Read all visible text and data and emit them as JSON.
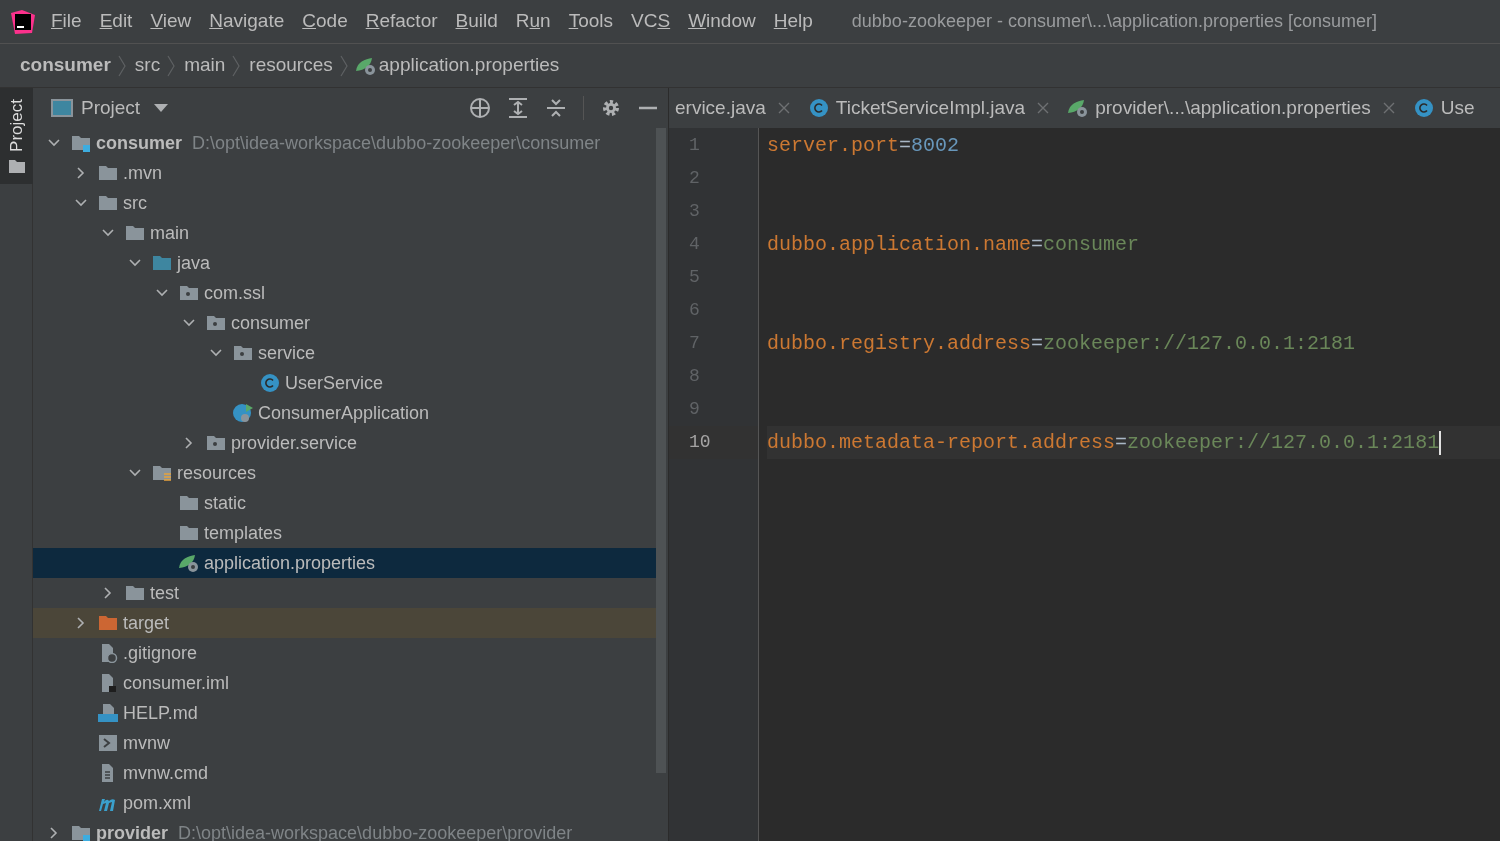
{
  "menu_bar": {
    "items": [
      {
        "mnemonic": "F",
        "after": "ile"
      },
      {
        "mnemonic": "E",
        "after": "dit"
      },
      {
        "mnemonic": "V",
        "after": "iew"
      },
      {
        "mnemonic": "N",
        "after": "avigate"
      },
      {
        "mnemonic": "C",
        "after": "ode"
      },
      {
        "mnemonic": "R",
        "after": "efactor"
      },
      {
        "mnemonic": "B",
        "after": "uild"
      },
      {
        "before": "R",
        "mnemonic": "u",
        "after": "n"
      },
      {
        "mnemonic": "T",
        "after": "ools"
      },
      {
        "before": "VC",
        "mnemonic": "S"
      },
      {
        "mnemonic": "W",
        "after": "indow"
      },
      {
        "mnemonic": "H",
        "after": "elp"
      }
    ],
    "title": "dubbo-zookeeper - consumer\\...\\application.properties [consumer]"
  },
  "breadcrumb": [
    {
      "label": "consumer",
      "kind": "module"
    },
    {
      "label": "src",
      "kind": "folder"
    },
    {
      "label": "main",
      "kind": "folder"
    },
    {
      "label": "resources",
      "kind": "folder"
    },
    {
      "label": "application.properties",
      "kind": "properties"
    }
  ],
  "side_stripe": {
    "tab": {
      "label": "Project",
      "selected": true
    }
  },
  "project_panel": {
    "title": "Project",
    "tree": [
      {
        "label": "consumer",
        "kind": "module",
        "path": "D:\\opt\\idea-workspace\\dubbo-zookeeper\\consumer",
        "expanded": true,
        "selected": false,
        "children": [
          {
            "label": ".mvn",
            "kind": "folder",
            "expanded": false,
            "selected": false
          },
          {
            "label": "src",
            "kind": "folder",
            "expanded": true,
            "selected": false,
            "children": [
              {
                "label": "main",
                "kind": "folder",
                "expanded": true,
                "selected": false,
                "children": [
                  {
                    "label": "java",
                    "kind": "source-folder",
                    "expanded": true,
                    "selected": false,
                    "children": [
                      {
                        "label": "com.ssl",
                        "kind": "package",
                        "expanded": true,
                        "selected": false,
                        "children": [
                          {
                            "label": "consumer",
                            "kind": "package",
                            "expanded": true,
                            "selected": false,
                            "children": [
                              {
                                "label": "service",
                                "kind": "package",
                                "expanded": true,
                                "selected": false,
                                "children": [
                                  {
                                    "label": "UserService",
                                    "kind": "class",
                                    "selected": false
                                  }
                                ]
                              },
                              {
                                "label": "ConsumerApplication",
                                "kind": "spring-class",
                                "selected": false
                              }
                            ]
                          },
                          {
                            "label": "provider.service",
                            "kind": "package",
                            "expanded": false,
                            "selected": false
                          }
                        ]
                      }
                    ]
                  },
                  {
                    "label": "resources",
                    "kind": "resource-folder",
                    "expanded": true,
                    "selected": false,
                    "children": [
                      {
                        "label": "static",
                        "kind": "folder",
                        "selected": false
                      },
                      {
                        "label": "templates",
                        "kind": "folder",
                        "selected": false
                      },
                      {
                        "label": "application.properties",
                        "kind": "properties",
                        "selected": true
                      }
                    ]
                  }
                ]
              },
              {
                "label": "test",
                "kind": "folder",
                "expanded": false,
                "selected": false
              }
            ]
          },
          {
            "label": "target",
            "kind": "excluded-folder",
            "expanded": false,
            "selected": false
          },
          {
            "label": ".gitignore",
            "kind": "gitignore",
            "selected": false
          },
          {
            "label": "consumer.iml",
            "kind": "iml",
            "selected": false
          },
          {
            "label": "HELP.md",
            "kind": "markdown",
            "selected": false
          },
          {
            "label": "mvnw",
            "kind": "script",
            "selected": false
          },
          {
            "label": "mvnw.cmd",
            "kind": "text",
            "selected": false
          },
          {
            "label": "pom.xml",
            "kind": "maven",
            "selected": false
          }
        ]
      },
      {
        "label": "provider",
        "kind": "module",
        "path": "D:\\opt\\idea-workspace\\dubbo-zookeeper\\provider",
        "expanded": false,
        "selected": false
      }
    ]
  },
  "editor": {
    "tabs": [
      {
        "label": "ervice.java",
        "kind": "none",
        "selected": false,
        "closable": true
      },
      {
        "label": "TicketServiceImpl.java",
        "kind": "class",
        "selected": false,
        "closable": true
      },
      {
        "label": "provider\\...\\application.properties",
        "kind": "properties",
        "selected": false,
        "closable": true
      },
      {
        "label": "Use",
        "kind": "class",
        "selected": false,
        "closable": false
      }
    ],
    "lines": [
      {
        "number": "1",
        "key": "server.port",
        "sep": "=",
        "value": "8002",
        "kind": "number",
        "current": false
      },
      {
        "number": "2",
        "current": false
      },
      {
        "number": "3",
        "current": false
      },
      {
        "number": "4",
        "key": "dubbo.application.name",
        "sep": "=",
        "value": "consumer",
        "kind": "string",
        "current": false
      },
      {
        "number": "5",
        "current": false
      },
      {
        "number": "6",
        "current": false
      },
      {
        "number": "7",
        "key": "dubbo.registry.address",
        "sep": "=",
        "value": "zookeeper://127.0.0.1:2181",
        "kind": "string",
        "current": false
      },
      {
        "number": "8",
        "current": false
      },
      {
        "number": "9",
        "current": false
      },
      {
        "number": "10",
        "key": "dubbo.metadata-report.address",
        "sep": "=",
        "value": "zookeeper://127.0.0.1:2181",
        "kind": "string",
        "current": true
      }
    ]
  }
}
